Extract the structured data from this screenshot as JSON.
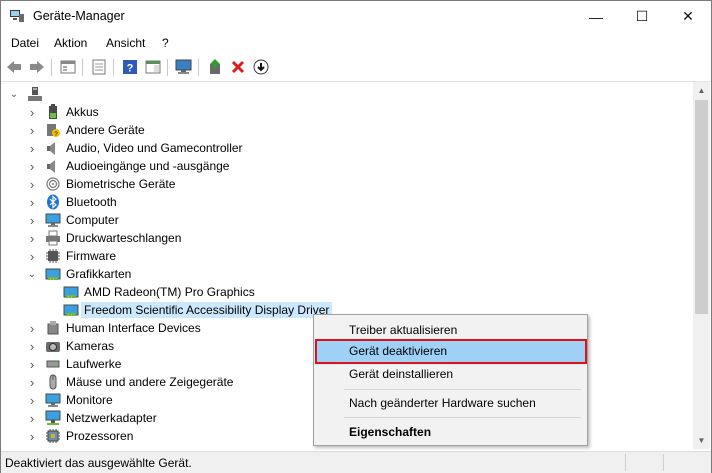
{
  "window": {
    "title": "Geräte-Manager",
    "icon": "device-manager-icon",
    "controls": {
      "minimize": "—",
      "maximize": "☐",
      "close": "✕"
    }
  },
  "menu": [
    "Datei",
    "Aktion",
    "Ansicht",
    "?"
  ],
  "toolbar": {
    "icons": [
      "back-arrow-icon",
      "forward-arrow-icon",
      "properties-sheet-icon",
      "view-list-icon",
      "help-icon",
      "action-pane-icon",
      "monitor-scan-icon",
      "update-driver-icon",
      "uninstall-x-icon",
      "download-icon"
    ]
  },
  "tree": {
    "root_icon": "computer-root-icon",
    "items": [
      {
        "label": "Akkus",
        "icon": "battery-icon",
        "expanded": false,
        "level": 1
      },
      {
        "label": "Andere Geräte",
        "icon": "unknown-device-icon",
        "expanded": false,
        "level": 1
      },
      {
        "label": "Audio, Video und Gamecontroller",
        "icon": "speaker-icon",
        "expanded": false,
        "level": 1
      },
      {
        "label": "Audioeingänge und -ausgänge",
        "icon": "speaker-icon",
        "expanded": false,
        "level": 1
      },
      {
        "label": "Biometrische Geräte",
        "icon": "fingerprint-icon",
        "expanded": false,
        "level": 1
      },
      {
        "label": "Bluetooth",
        "icon": "bluetooth-icon",
        "expanded": false,
        "level": 1
      },
      {
        "label": "Computer",
        "icon": "monitor-icon",
        "expanded": false,
        "level": 1
      },
      {
        "label": "Druckwarteschlangen",
        "icon": "printer-icon",
        "expanded": false,
        "level": 1
      },
      {
        "label": "Firmware",
        "icon": "chip-icon",
        "expanded": false,
        "level": 1
      },
      {
        "label": "Grafikkarten",
        "icon": "display-adapter-icon",
        "expanded": true,
        "level": 1
      },
      {
        "label": "AMD Radeon(TM) Pro Graphics",
        "icon": "display-adapter-icon",
        "level": 2
      },
      {
        "label": "Freedom Scientific Accessibility Display Driver",
        "icon": "display-adapter-icon",
        "level": 2,
        "selected": true
      },
      {
        "label": "Human Interface Devices",
        "icon": "hid-icon",
        "expanded": false,
        "level": 1
      },
      {
        "label": "Kameras",
        "icon": "camera-icon",
        "expanded": false,
        "level": 1
      },
      {
        "label": "Laufwerke",
        "icon": "drive-icon",
        "expanded": false,
        "level": 1
      },
      {
        "label": "Mäuse und andere Zeigegeräte",
        "icon": "mouse-icon",
        "expanded": false,
        "level": 1
      },
      {
        "label": "Monitore",
        "icon": "monitor-icon",
        "expanded": false,
        "level": 1
      },
      {
        "label": "Netzwerkadapter",
        "icon": "network-adapter-icon",
        "expanded": false,
        "level": 1
      },
      {
        "label": "Prozessoren",
        "icon": "processor-icon",
        "expanded": false,
        "level": 1
      }
    ]
  },
  "context_menu": {
    "items": [
      {
        "label": "Treiber aktualisieren"
      },
      {
        "label": "Gerät deaktivieren",
        "highlighted": true
      },
      {
        "label": "Gerät deinstallieren"
      },
      {
        "label": "Nach geänderter Hardware suchen"
      },
      {
        "label": "Eigenschaften",
        "bold": true
      }
    ]
  },
  "status": {
    "text": "Deaktiviert das ausgewählte Gerät."
  },
  "colors": {
    "selection": "#cce8ff",
    "menu_highlight": "#9fd0f5",
    "highlight_border": "#e0101a"
  }
}
